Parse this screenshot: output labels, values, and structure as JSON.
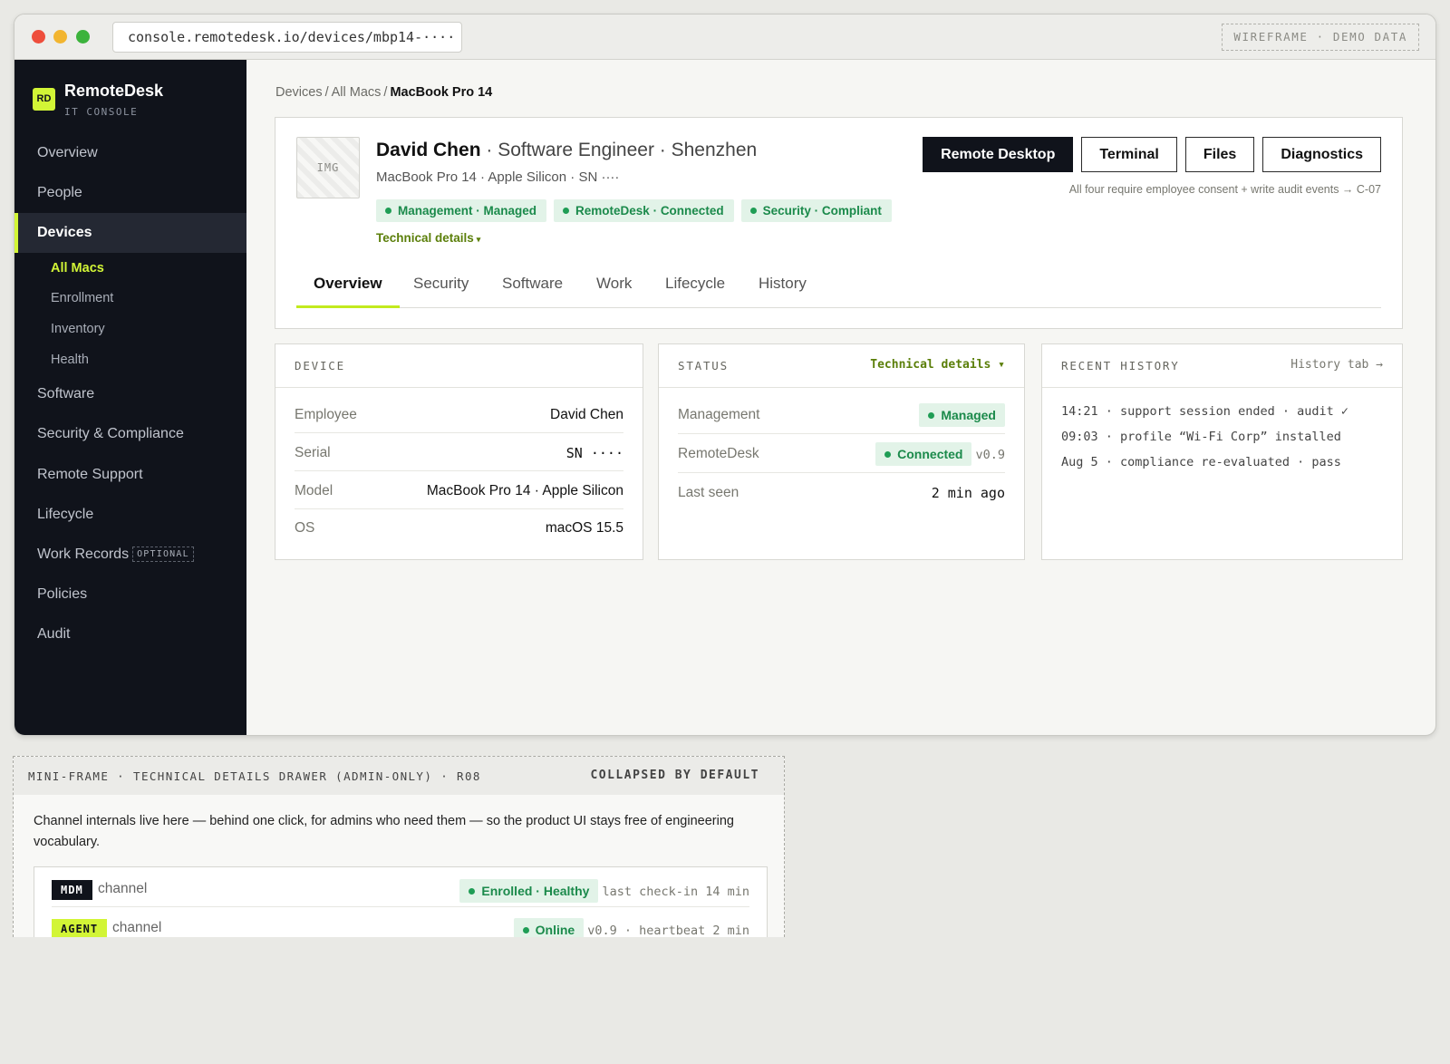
{
  "browser": {
    "url": "console.remotedesk.io/devices/mbp14-····",
    "badge": "WIREFRAME · DEMO DATA"
  },
  "sidebar": {
    "logo": "RD",
    "app_name": "RemoteDesk",
    "app_sub": "IT CONSOLE",
    "items": [
      {
        "label": "Overview"
      },
      {
        "label": "People"
      },
      {
        "label": "Devices"
      },
      {
        "label": "Software"
      },
      {
        "label": "Security & Compliance"
      },
      {
        "label": "Remote Support"
      },
      {
        "label": "Lifecycle"
      },
      {
        "label": "Work Records",
        "badge": "OPTIONAL"
      },
      {
        "label": "Policies"
      },
      {
        "label": "Audit"
      }
    ],
    "subitems": [
      {
        "label": "All Macs"
      },
      {
        "label": "Enrollment"
      },
      {
        "label": "Inventory"
      },
      {
        "label": "Health"
      }
    ]
  },
  "breadcrumb": {
    "items": [
      "Devices",
      "All Macs"
    ],
    "sep": "/",
    "current": "MacBook Pro 14"
  },
  "device": {
    "avatar": "IMG",
    "name": "David Chen",
    "role_location": " · Software Engineer · Shenzhen",
    "model_line": "MacBook Pro 14 · Apple Silicon · SN  ····",
    "pills": [
      "Management · Managed",
      "RemoteDesk · Connected",
      "Security · Compliant"
    ],
    "tech_link": "Technical details",
    "tech_caret": "▾"
  },
  "actions": {
    "remote_desktop": "Remote Desktop",
    "terminal": "Terminal",
    "files": "Files",
    "diagnostics": "Diagnostics",
    "consent": "All four require employee consent + write audit events → C-07"
  },
  "tabs": [
    "Overview",
    "Security",
    "Software",
    "Work",
    "Lifecycle",
    "History"
  ],
  "device_panel": {
    "title": "DEVICE",
    "rows": [
      {
        "k": "Employee",
        "v": "David Chen"
      },
      {
        "k": "Serial",
        "v": "SN ····"
      },
      {
        "k": "Model",
        "v": "MacBook Pro 14 · Apple Silicon"
      },
      {
        "k": "OS",
        "v": "macOS 15.5"
      }
    ]
  },
  "status_panel": {
    "title": "STATUS",
    "link": "Technical details ▾",
    "rows": [
      {
        "k": "Management",
        "v": "Managed"
      },
      {
        "k": "RemoteDesk",
        "v": "Connected",
        "extra": "v0.9"
      },
      {
        "k": "Last seen",
        "v": "2 min ago"
      }
    ]
  },
  "history_panel": {
    "title": "RECENT HISTORY",
    "link": "History tab →",
    "items": [
      "14:21 · support session ended · audit ✓",
      "09:03 · profile “Wi-Fi Corp” installed",
      "Aug 5 · compliance re-evaluated · pass"
    ]
  },
  "mini_frame": {
    "title": "MINI-FRAME · TECHNICAL DETAILS DRAWER (ADMIN-ONLY) · R08",
    "state": "COLLAPSED BY DEFAULT",
    "description": "Channel internals live here — behind one click, for admins who need them — so the product UI stays free of engineering vocabulary.",
    "channels": [
      {
        "tag": "MDM",
        "label": "channel",
        "status": "Enrolled · Healthy",
        "meta": "last check-in 14 min"
      },
      {
        "tag": "AGENT",
        "label": "channel",
        "status": "Online",
        "meta": "v0.9 · heartbeat 2 min"
      }
    ]
  },
  "colors": {
    "accent": "#d2f536",
    "sidebar_bg": "#10131b",
    "status_green": "#1b8a4b"
  }
}
